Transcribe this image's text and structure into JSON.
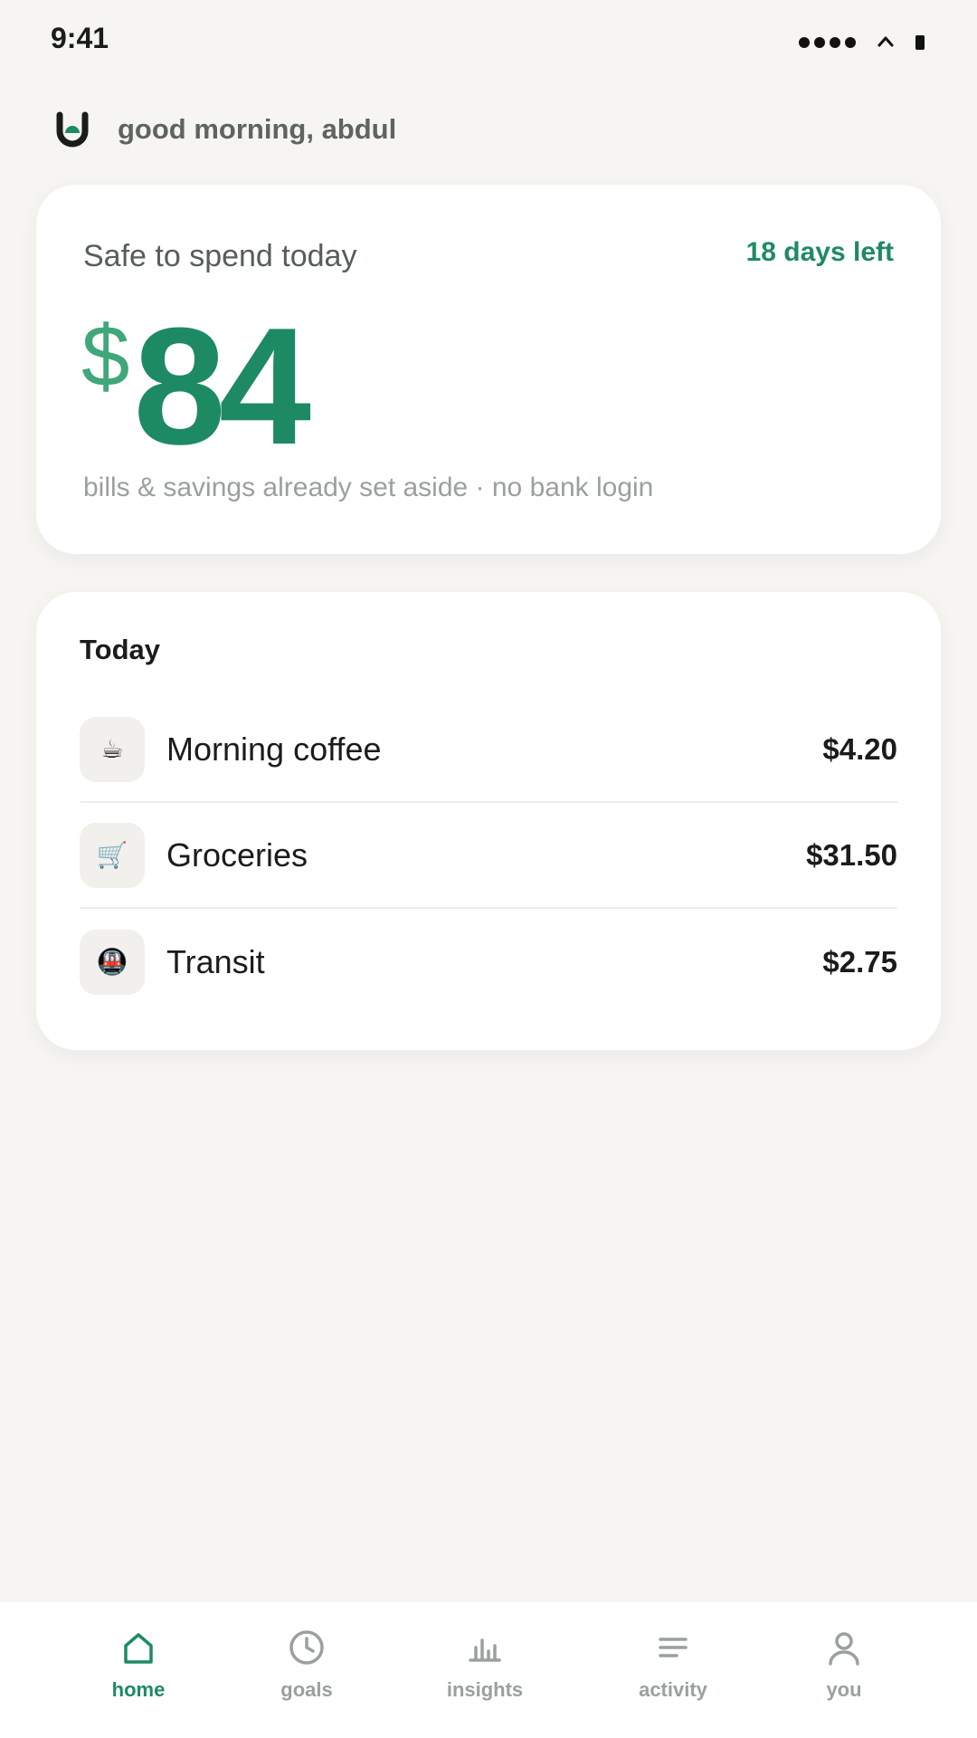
{
  "status_bar": {
    "time": "9:41"
  },
  "header": {
    "greeting": "good morning, abdul"
  },
  "spend_card": {
    "label": "Safe to spend today",
    "days_left": "18 days left",
    "currency": "$",
    "amount": "84",
    "note": "bills & savings already set aside · no bank login"
  },
  "today": {
    "title": "Today",
    "transactions": [
      {
        "icon": "coffee-icon",
        "emoji": "☕",
        "name": "Morning coffee",
        "amount": "$4.20"
      },
      {
        "icon": "cart-icon",
        "emoji": "🛒",
        "name": "Groceries",
        "amount": "$31.50"
      },
      {
        "icon": "metro-icon",
        "emoji": "🚇",
        "name": "Transit",
        "amount": "$2.75"
      }
    ]
  },
  "nav": {
    "items": [
      {
        "label": "home",
        "icon": "home-icon",
        "active": true
      },
      {
        "label": "goals",
        "icon": "clock-icon",
        "active": false
      },
      {
        "label": "insights",
        "icon": "bar-chart-icon",
        "active": false
      },
      {
        "label": "activity",
        "icon": "list-icon",
        "active": false
      },
      {
        "label": "you",
        "icon": "person-icon",
        "active": false
      }
    ]
  },
  "colors": {
    "accent": "#1e8a63",
    "accent_light": "#3fa77a",
    "background": "#f6f5f1",
    "muted_text": "#9aa09d"
  }
}
